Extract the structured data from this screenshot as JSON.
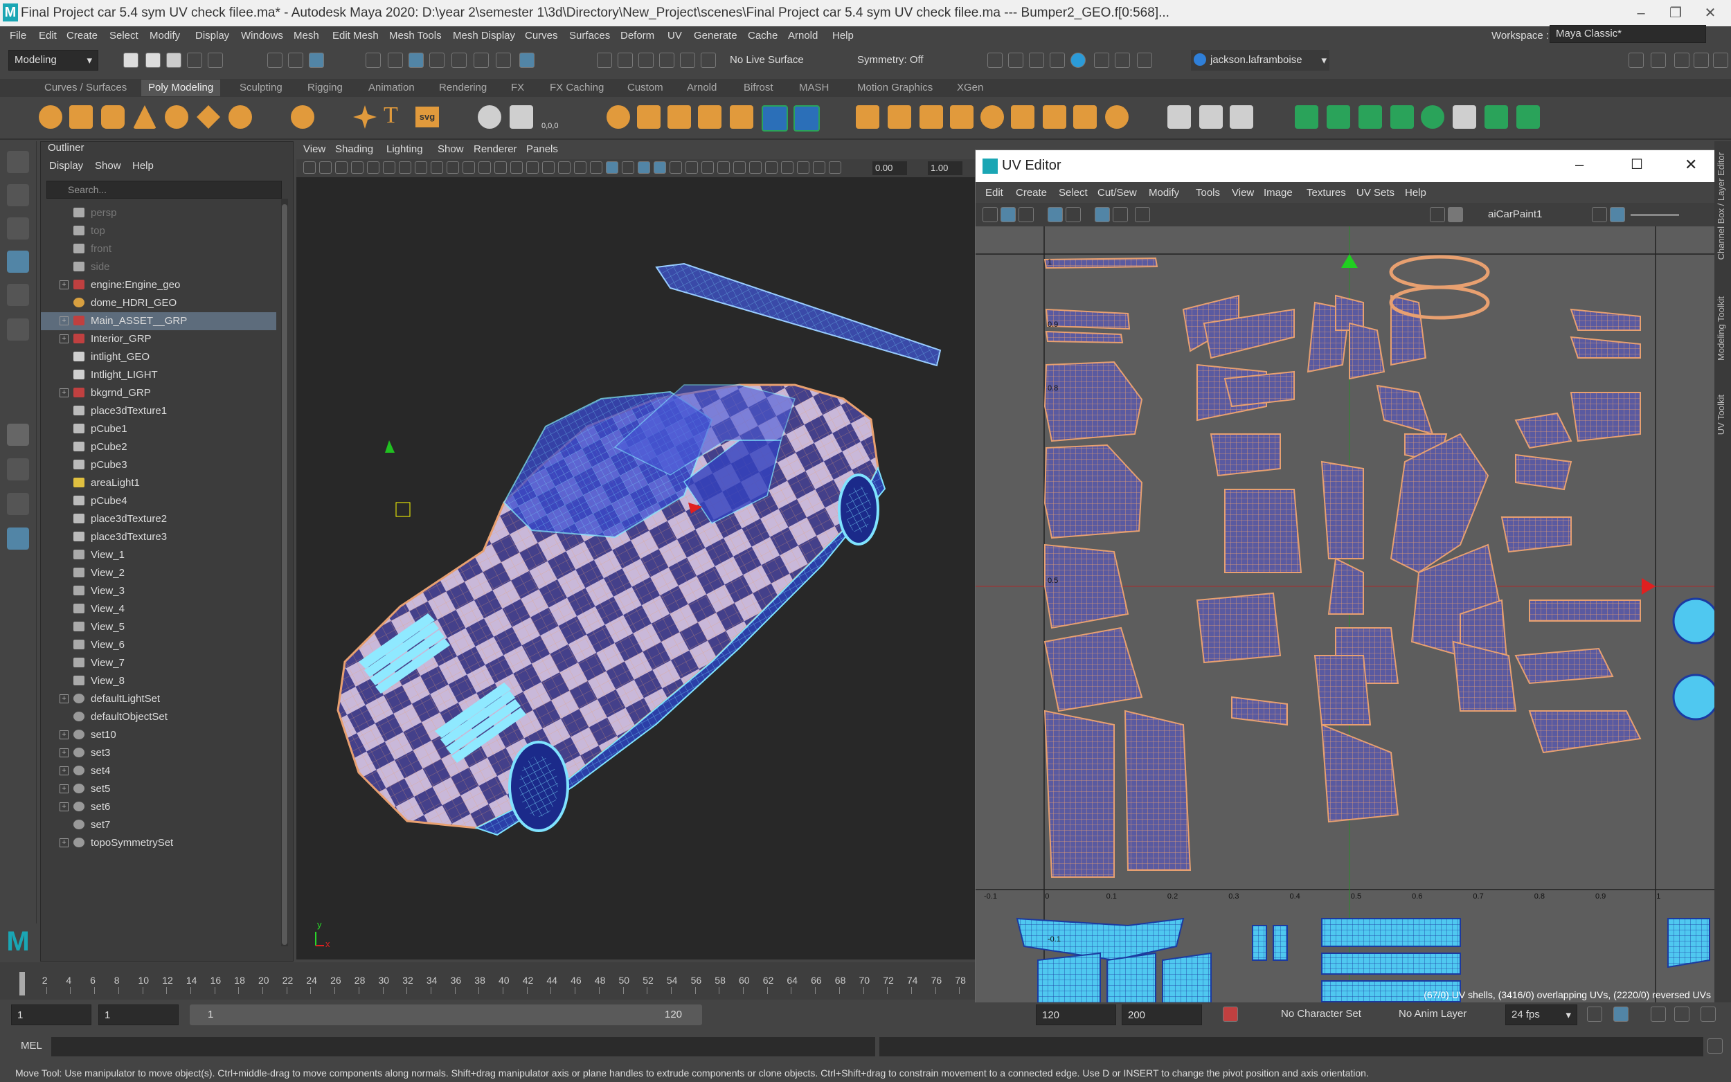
{
  "window": {
    "title": "Final Project car 5.4 sym UV check filee.ma* - Autodesk Maya 2020: D:\\year 2\\semester 1\\3d\\Directory\\New_Project\\scenes\\Final Project car 5.4 sym UV check filee.ma  ---  Bumper2_GEO.f[0:568]...",
    "logo": "M"
  },
  "menubar": [
    "File",
    "Edit",
    "Create",
    "Select",
    "Modify",
    "Display",
    "Windows",
    "Mesh",
    "Edit Mesh",
    "Mesh Tools",
    "Mesh Display",
    "Curves",
    "Surfaces",
    "Deform",
    "UV",
    "Generate",
    "Cache",
    "Arnold",
    "Help"
  ],
  "workspace": {
    "label": "Workspace :",
    "value": "Maya Classic*"
  },
  "statusline": {
    "mode": "Modeling",
    "live_surface": "No Live Surface",
    "symmetry": "Symmetry: Off",
    "user": "jackson.laframboise"
  },
  "shelf_tabs": [
    "Curves / Surfaces",
    "Poly Modeling",
    "Sculpting",
    "Rigging",
    "Animation",
    "Rendering",
    "FX",
    "FX Caching",
    "Custom",
    "Arnold",
    "Bifrost",
    "MASH",
    "Motion Graphics",
    "XGen"
  ],
  "shelf_active": "Poly Modeling",
  "shelf_text_icons": {
    "type": "T",
    "svg": "svg",
    "coords": "0,0,0"
  },
  "outliner": {
    "title": "Outliner",
    "menu": [
      "Display",
      "Show",
      "Help"
    ],
    "search_placeholder": "Search...",
    "items": [
      {
        "label": "persp",
        "icon": "camera",
        "dim": true
      },
      {
        "label": "top",
        "icon": "camera",
        "dim": true
      },
      {
        "label": "front",
        "icon": "camera",
        "dim": true
      },
      {
        "label": "side",
        "icon": "camera",
        "dim": true
      },
      {
        "label": "engine:Engine_geo",
        "icon": "mesh",
        "expand": true
      },
      {
        "label": "dome_HDRI_GEO",
        "icon": "light"
      },
      {
        "label": "Main_ASSET__GRP",
        "icon": "mesh",
        "expand": true,
        "selected": true
      },
      {
        "label": "Interior_GRP",
        "icon": "mesh",
        "expand": true
      },
      {
        "label": "intlight_GEO",
        "icon": "group"
      },
      {
        "label": "Intlight_LIGHT",
        "icon": "group"
      },
      {
        "label": "bkgrnd_GRP",
        "icon": "mesh",
        "expand": true
      },
      {
        "label": "place3dTexture1",
        "icon": "texture"
      },
      {
        "label": "pCube1",
        "icon": "texture"
      },
      {
        "label": "pCube2",
        "icon": "texture"
      },
      {
        "label": "pCube3",
        "icon": "texture"
      },
      {
        "label": "areaLight1",
        "icon": "arealight"
      },
      {
        "label": "pCube4",
        "icon": "texture"
      },
      {
        "label": "place3dTexture2",
        "icon": "texture"
      },
      {
        "label": "place3dTexture3",
        "icon": "texture"
      },
      {
        "label": "View_1",
        "icon": "camera"
      },
      {
        "label": "View_2",
        "icon": "camera"
      },
      {
        "label": "View_3",
        "icon": "camera"
      },
      {
        "label": "View_4",
        "icon": "camera"
      },
      {
        "label": "View_5",
        "icon": "camera"
      },
      {
        "label": "View_6",
        "icon": "camera"
      },
      {
        "label": "View_7",
        "icon": "camera"
      },
      {
        "label": "View_8",
        "icon": "camera"
      },
      {
        "label": "defaultLightSet",
        "icon": "set",
        "expand": true
      },
      {
        "label": "defaultObjectSet",
        "icon": "set"
      },
      {
        "label": "set10",
        "icon": "set",
        "expand": true
      },
      {
        "label": "set3",
        "icon": "set",
        "expand": true
      },
      {
        "label": "set4",
        "icon": "set",
        "expand": true
      },
      {
        "label": "set5",
        "icon": "set",
        "expand": true
      },
      {
        "label": "set6",
        "icon": "set",
        "expand": true
      },
      {
        "label": "set7",
        "icon": "set"
      },
      {
        "label": "topoSymmetrySet",
        "icon": "set",
        "expand": true
      }
    ]
  },
  "viewport": {
    "menu": [
      "View",
      "Shading",
      "Lighting",
      "Show",
      "Renderer",
      "Panels"
    ],
    "field1": "0.00",
    "field2": "1.00",
    "axis_y": "y",
    "axis_x": "x"
  },
  "uv_editor": {
    "title": "UV Editor",
    "menu": [
      "Edit",
      "Create",
      "Select",
      "Cut/Sew",
      "Modify",
      "Tools",
      "View",
      "Image",
      "Textures",
      "UV Sets",
      "Help"
    ],
    "texture": "aiCarPaint1",
    "status": "(67/0) UV shells, (3416/0) overlapping UVs, (2220/0) reversed UVs",
    "v_ticks": [
      "1",
      "0.9",
      "0.8",
      "0.5",
      "-0.1"
    ],
    "u_ticks": [
      "-0.1",
      "0",
      "0.1",
      "0.2",
      "0.3",
      "0.4",
      "0.5",
      "0.6",
      "0.7",
      "0.8",
      "0.9",
      "1"
    ]
  },
  "right_tabs": [
    "Channel Box / Layer Editor",
    "Modeling Toolkit",
    "UV Toolkit"
  ],
  "timeline": {
    "ticks": [
      "1",
      "2",
      "4",
      "6",
      "8",
      "10",
      "12",
      "14",
      "16",
      "18",
      "20",
      "22",
      "24",
      "26",
      "28",
      "30",
      "32",
      "34",
      "36",
      "38",
      "40",
      "42",
      "44",
      "46",
      "48",
      "50",
      "52",
      "54",
      "56",
      "58",
      "60",
      "62",
      "64",
      "66",
      "68",
      "70",
      "72",
      "74",
      "76",
      "78"
    ]
  },
  "range": {
    "start": "1",
    "current": "1",
    "slider_start": "1",
    "slider_end": "120",
    "end": "120",
    "max": "200",
    "character_set": "No Character Set",
    "anim_layer": "No Anim Layer",
    "fps": "24 fps"
  },
  "mel": {
    "label": "MEL"
  },
  "help_line": "Move Tool: Use manipulator to move object(s). Ctrl+middle-drag to move components along normals. Shift+drag manipulator axis or plane handles to extrude components or clone objects. Ctrl+Shift+drag to constrain movement to a connected edge. Use D or INSERT to change the pivot position and axis orientation.",
  "colors": {
    "accent": "#5285a6",
    "uv_shell_fill": "#5a5aa0",
    "uv_shell_edge": "#e8a070",
    "mesh_blue": "#2b3fa8",
    "check_light": "#c8b8d8"
  }
}
